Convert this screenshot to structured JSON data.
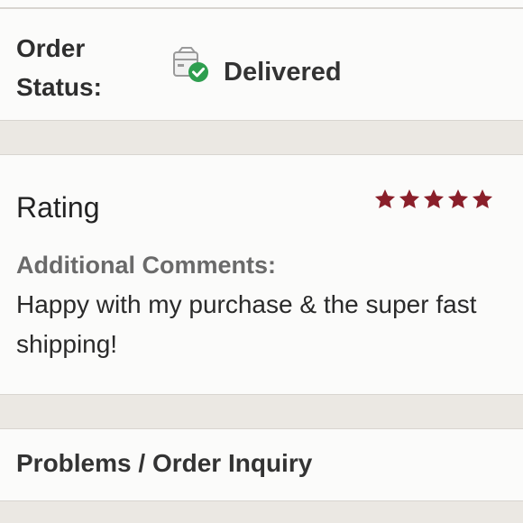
{
  "order": {
    "status_label": "Order Status:",
    "status_value": "Delivered",
    "status_icon": "package-delivered-icon"
  },
  "rating": {
    "title": "Rating",
    "stars": 5,
    "max_stars": 5,
    "star_color": "#8a1f2a",
    "comments_label": "Additional Comments:",
    "comments_text": "Happy with my purchase & the super fast shipping!"
  },
  "problems": {
    "label": "Problems / Order Inquiry"
  },
  "colors": {
    "background": "#ebe8e3",
    "card": "#fbfbfa",
    "success": "#2e9e4f"
  }
}
